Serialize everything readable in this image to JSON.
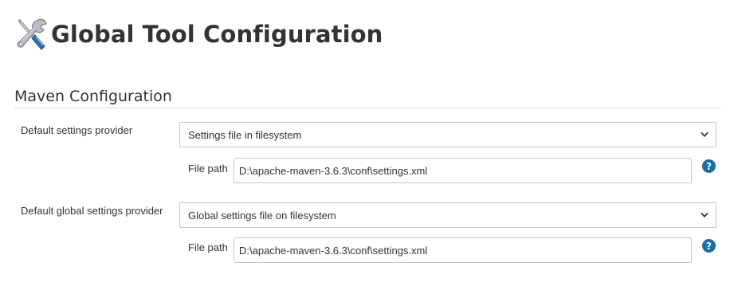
{
  "header": {
    "title": "Global Tool Configuration",
    "icon": "wrench-screwdriver-icon"
  },
  "section": {
    "title": "Maven Configuration"
  },
  "settings": {
    "default_label": "Default settings provider",
    "default_select_value": "Settings file in filesystem",
    "default_file_path_label": "File path",
    "default_file_path_value": "D:\\apache-maven-3.6.3\\conf\\settings.xml",
    "global_label": "Default global settings provider",
    "global_select_value": "Global settings file on filesystem",
    "global_file_path_label": "File path",
    "global_file_path_value": "D:\\apache-maven-3.6.3\\conf\\settings.xml"
  },
  "colors": {
    "help_icon": "#1a6da8",
    "border": "#c6c6c6",
    "text": "#333333"
  }
}
